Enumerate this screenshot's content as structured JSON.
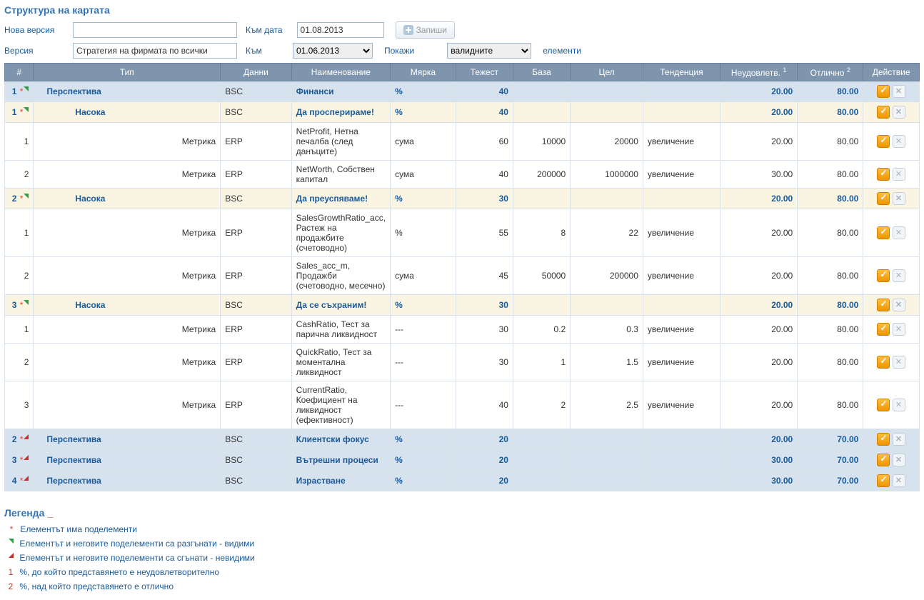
{
  "page": {
    "title": "Структура на картата"
  },
  "form": {
    "new_version_label": "Нова версия",
    "new_version_value": "",
    "to_date_label": "Към дата",
    "to_date_value": "01.08.2013",
    "save_label": "Запиши",
    "version_label": "Версия",
    "version_value": "Стратегия на фирмата по всички",
    "to_label": "Към",
    "to_value": "01.06.2013",
    "show_label": "Покажи",
    "elements_select_value": "валидните",
    "elements_label": "елементи"
  },
  "columns": {
    "num": "#",
    "type": "Тип",
    "data": "Данни",
    "name": "Наименование",
    "unit": "Мярка",
    "weight": "Тежест",
    "base": "База",
    "target": "Цел",
    "trend": "Тенденция",
    "unsat": "Неудовлетв.",
    "unsat_sup": "1",
    "excellent": "Отлично",
    "excellent_sup": "2",
    "action": "Действие"
  },
  "rows": [
    {
      "level": 0,
      "num": "1",
      "star": true,
      "expanded": true,
      "type": "Перспектива",
      "data": "BSC",
      "name": "Финанси",
      "unit": "%",
      "weight": "40",
      "base": "",
      "target": "",
      "trend": "",
      "unsat": "20.00",
      "excel": "80.00"
    },
    {
      "level": 1,
      "num": "1",
      "star": true,
      "expanded": true,
      "type": "Насока",
      "data": "BSC",
      "name": "Да просперираме!",
      "unit": "%",
      "weight": "40",
      "base": "",
      "target": "",
      "trend": "",
      "unsat": "20.00",
      "excel": "80.00"
    },
    {
      "level": 2,
      "num": "1",
      "star": false,
      "type": "Метрика",
      "data": "ERP",
      "name": "NetProfit, Нетна печалба (след данъците)",
      "unit": "сума",
      "weight": "60",
      "base": "10000",
      "target": "20000",
      "trend": "увеличение",
      "unsat": "20.00",
      "excel": "80.00"
    },
    {
      "level": 2,
      "num": "2",
      "star": false,
      "type": "Метрика",
      "data": "ERP",
      "name": "NetWorth, Собствен капитал",
      "unit": "сума",
      "weight": "40",
      "base": "200000",
      "target": "1000000",
      "trend": "увеличение",
      "unsat": "30.00",
      "excel": "80.00"
    },
    {
      "level": 1,
      "num": "2",
      "star": true,
      "expanded": true,
      "type": "Насока",
      "data": "BSC",
      "name": "Да преуспяваме!",
      "unit": "%",
      "weight": "30",
      "base": "",
      "target": "",
      "trend": "",
      "unsat": "20.00",
      "excel": "80.00"
    },
    {
      "level": 2,
      "num": "1",
      "star": false,
      "type": "Метрика",
      "data": "ERP",
      "name": "SalesGrowthRatio_acc, Растеж на продажбите (счетоводно)",
      "unit": "%",
      "weight": "55",
      "base": "8",
      "target": "22",
      "trend": "увеличение",
      "unsat": "20.00",
      "excel": "80.00"
    },
    {
      "level": 2,
      "num": "2",
      "star": false,
      "type": "Метрика",
      "data": "ERP",
      "name": "Sales_acc_m, Продажби (счетоводно, месечно)",
      "unit": "сума",
      "weight": "45",
      "base": "50000",
      "target": "200000",
      "trend": "увеличение",
      "unsat": "20.00",
      "excel": "80.00"
    },
    {
      "level": 1,
      "num": "3",
      "star": true,
      "expanded": true,
      "type": "Насока",
      "data": "BSC",
      "name": "Да се съхраним!",
      "unit": "%",
      "weight": "30",
      "base": "",
      "target": "",
      "trend": "",
      "unsat": "20.00",
      "excel": "80.00"
    },
    {
      "level": 2,
      "num": "1",
      "star": false,
      "type": "Метрика",
      "data": "ERP",
      "name": "CashRatio, Тест за парична ликвидност",
      "unit": "---",
      "weight": "30",
      "base": "0.2",
      "target": "0.3",
      "trend": "увеличение",
      "unsat": "20.00",
      "excel": "80.00"
    },
    {
      "level": 2,
      "num": "2",
      "star": false,
      "type": "Метрика",
      "data": "ERP",
      "name": "QuickRatio, Тест за моментална ликвидност",
      "unit": "---",
      "weight": "30",
      "base": "1",
      "target": "1.5",
      "trend": "увеличение",
      "unsat": "20.00",
      "excel": "80.00"
    },
    {
      "level": 2,
      "num": "3",
      "star": false,
      "type": "Метрика",
      "data": "ERP",
      "name": "CurrentRatio, Коефициент на ликвидност (ефективност)",
      "unit": "---",
      "weight": "40",
      "base": "2",
      "target": "2.5",
      "trend": "увеличение",
      "unsat": "20.00",
      "excel": "80.00"
    },
    {
      "level": 0,
      "num": "2",
      "star": true,
      "expanded": false,
      "type": "Перспектива",
      "data": "BSC",
      "name": "Клиентски фокус",
      "unit": "%",
      "weight": "20",
      "base": "",
      "target": "",
      "trend": "",
      "unsat": "20.00",
      "excel": "70.00"
    },
    {
      "level": 0,
      "num": "3",
      "star": true,
      "expanded": false,
      "type": "Перспектива",
      "data": "BSC",
      "name": "Вътрешни процеси",
      "unit": "%",
      "weight": "20",
      "base": "",
      "target": "",
      "trend": "",
      "unsat": "30.00",
      "excel": "70.00"
    },
    {
      "level": 0,
      "num": "4",
      "star": true,
      "expanded": false,
      "type": "Перспектива",
      "data": "BSC",
      "name": "Израстване",
      "unit": "%",
      "weight": "20",
      "base": "",
      "target": "",
      "trend": "",
      "unsat": "30.00",
      "excel": "70.00"
    }
  ],
  "legend": {
    "title": "Легенда",
    "items": [
      {
        "mark_type": "star",
        "text": "Елементът има поделементи"
      },
      {
        "mark_type": "tri_green",
        "text": "Елементът и неговите поделементи са разгънати - видими"
      },
      {
        "mark_type": "tri_red",
        "text": "Елементът и неговите поделементи са сгънати - невидими"
      },
      {
        "mark_type": "num",
        "mark": "1",
        "text": "%, до който представянето е неудовлетворително"
      },
      {
        "mark_type": "num",
        "mark": "2",
        "text": "%, над който представянето е отлично"
      }
    ]
  }
}
